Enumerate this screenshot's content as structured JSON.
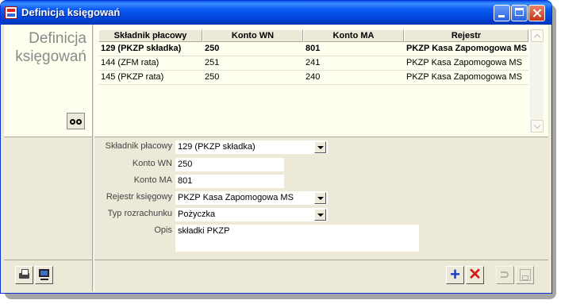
{
  "window": {
    "title": "Definicja księgowań"
  },
  "left_panel": {
    "title_line1": "Definicja",
    "title_line2": "księgowań"
  },
  "grid": {
    "columns": [
      "Składnik płacowy",
      "Konto WN",
      "Konto MA",
      "Rejestr"
    ],
    "rows": [
      [
        "129 (PKZP składka)",
        "250",
        "801",
        "PKZP Kasa Zapomogowa MS"
      ],
      [
        "144 (ZFM rata)",
        "251",
        "241",
        "PKZP Kasa Zapomogowa MS"
      ],
      [
        "145 (PKZP rata)",
        "250",
        "240",
        "PKZP Kasa Zapomogowa MS"
      ]
    ],
    "selected_row": 0
  },
  "form": {
    "skladnik": {
      "label": "Składnik płacowy",
      "value": "129 (PKZP składka)"
    },
    "konto_wn": {
      "label": "Konto WN",
      "value": "250"
    },
    "konto_ma": {
      "label": "Konto MA",
      "value": "801"
    },
    "rejestr": {
      "label": "Rejestr księgowy",
      "value": "PKZP Kasa Zapomogowa MS"
    },
    "typ": {
      "label": "Typ rozrachunku",
      "value": "Pożyczka"
    },
    "opis": {
      "label": "Opis",
      "value": "składki PKZP"
    }
  },
  "toolbar": {
    "add_symbol": "+",
    "delete_symbol": "✕"
  },
  "colors": {
    "titlebar": "#0054E3",
    "panel": "#FFFFEF",
    "face": "#ECE9D8",
    "add": "#1A3FBF",
    "delete": "#D41A1A"
  }
}
